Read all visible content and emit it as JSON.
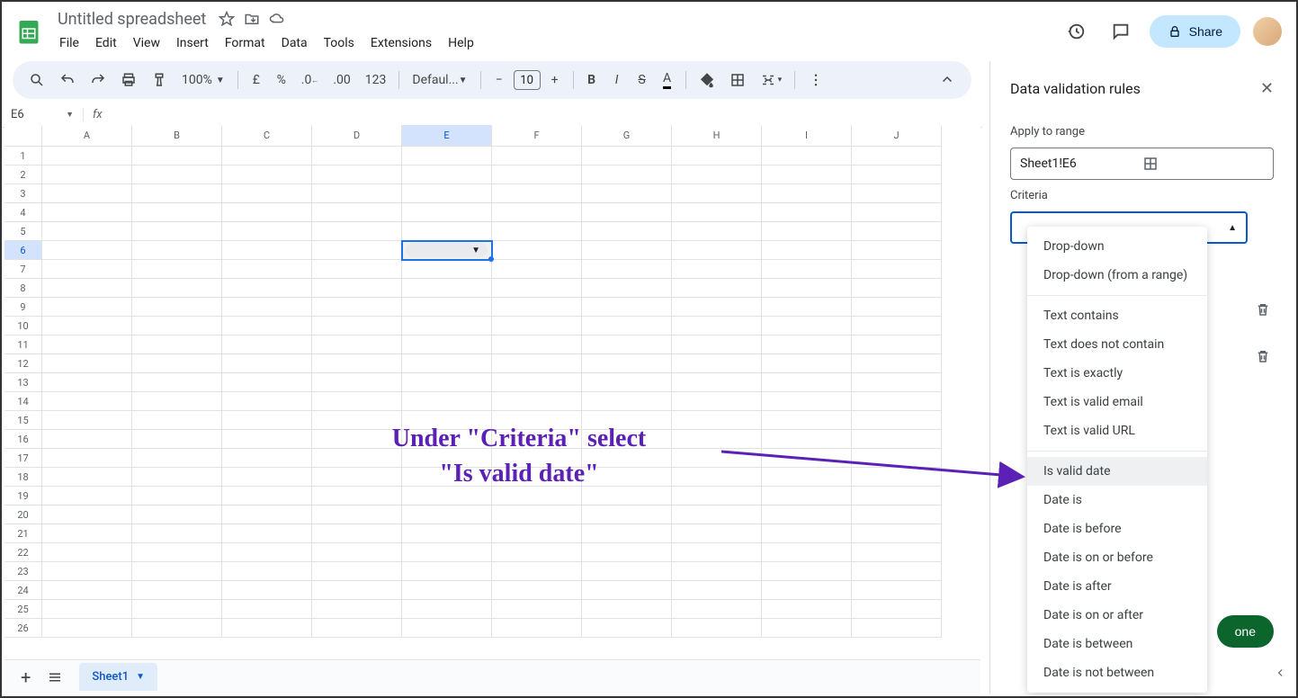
{
  "app": {
    "title": "Untitled spreadsheet"
  },
  "menu": [
    "File",
    "Edit",
    "View",
    "Insert",
    "Format",
    "Data",
    "Tools",
    "Extensions",
    "Help"
  ],
  "toolbar": {
    "zoom": "100%",
    "font": "Defaul...",
    "font_size": "10",
    "currency": "£",
    "percent": "%",
    "number_fmt": "123"
  },
  "share": {
    "label": "Share"
  },
  "name_box": {
    "value": "E6"
  },
  "grid": {
    "columns": [
      "A",
      "B",
      "C",
      "D",
      "E",
      "F",
      "G",
      "H",
      "I",
      "J"
    ],
    "row_count": 26,
    "active_col": "E",
    "active_row": 6
  },
  "sheet_tabs": {
    "active": "Sheet1"
  },
  "panel": {
    "title": "Data validation rules",
    "apply_label": "Apply to range",
    "range": "Sheet1!E6",
    "criteria_label": "Criteria",
    "done": "one"
  },
  "dropdown": {
    "group1": [
      "Drop-down",
      "Drop-down (from a range)"
    ],
    "group2": [
      "Text contains",
      "Text does not contain",
      "Text is exactly",
      "Text is valid email",
      "Text is valid URL"
    ],
    "group3": [
      "Is valid date",
      "Date is",
      "Date is before",
      "Date is on or before",
      "Date is after",
      "Date is on or after",
      "Date is between",
      "Date is not between"
    ],
    "hovered": "Is valid date"
  },
  "annotation": {
    "line1": "Under \"Criteria\" select",
    "line2": "\"Is valid date\""
  }
}
